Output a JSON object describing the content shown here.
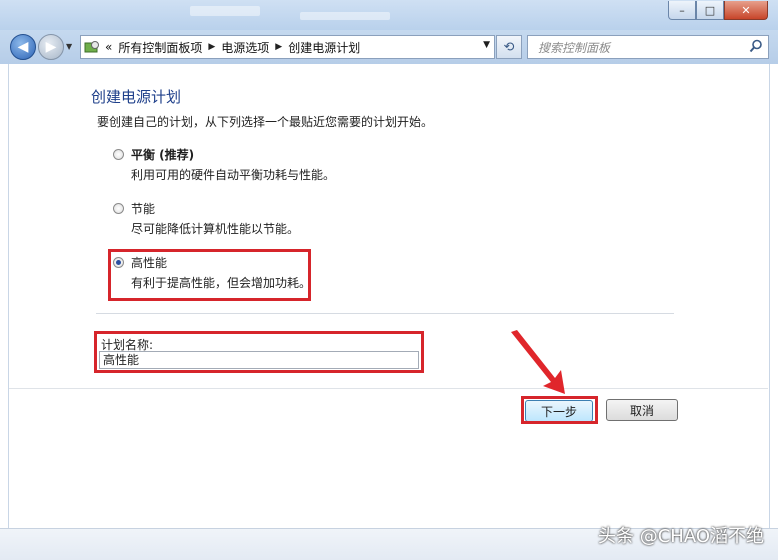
{
  "window": {
    "min_glyph": "–",
    "max_glyph": "□",
    "close_glyph": "✕"
  },
  "address_bar": {
    "chevron": "«",
    "breadcrumbs": [
      "所有控制面板项",
      "电源选项",
      "创建电源计划"
    ]
  },
  "search": {
    "placeholder": "搜索控制面板"
  },
  "page": {
    "title": "创建电源计划",
    "subtitle": "要创建自己的计划，从下列选择一个最贴近您需要的计划开始。"
  },
  "options": [
    {
      "title": "平衡 (推荐)",
      "description": "利用可用的硬件自动平衡功耗与性能。",
      "checked": false
    },
    {
      "title": "节能",
      "description": "尽可能降低计算机性能以节能。",
      "checked": false
    },
    {
      "title": "高性能",
      "description": "有利于提高性能，但会增加功耗。",
      "checked": true
    }
  ],
  "plan_name": {
    "label": "计划名称:",
    "value": "高性能"
  },
  "buttons": {
    "next": "下一步",
    "cancel": "取消"
  },
  "watermark": "头条 @CHAO滔不绝",
  "colors": {
    "highlight": "#d6252b",
    "title_blue": "#1e3f8a",
    "arrow": "#e0262b"
  }
}
